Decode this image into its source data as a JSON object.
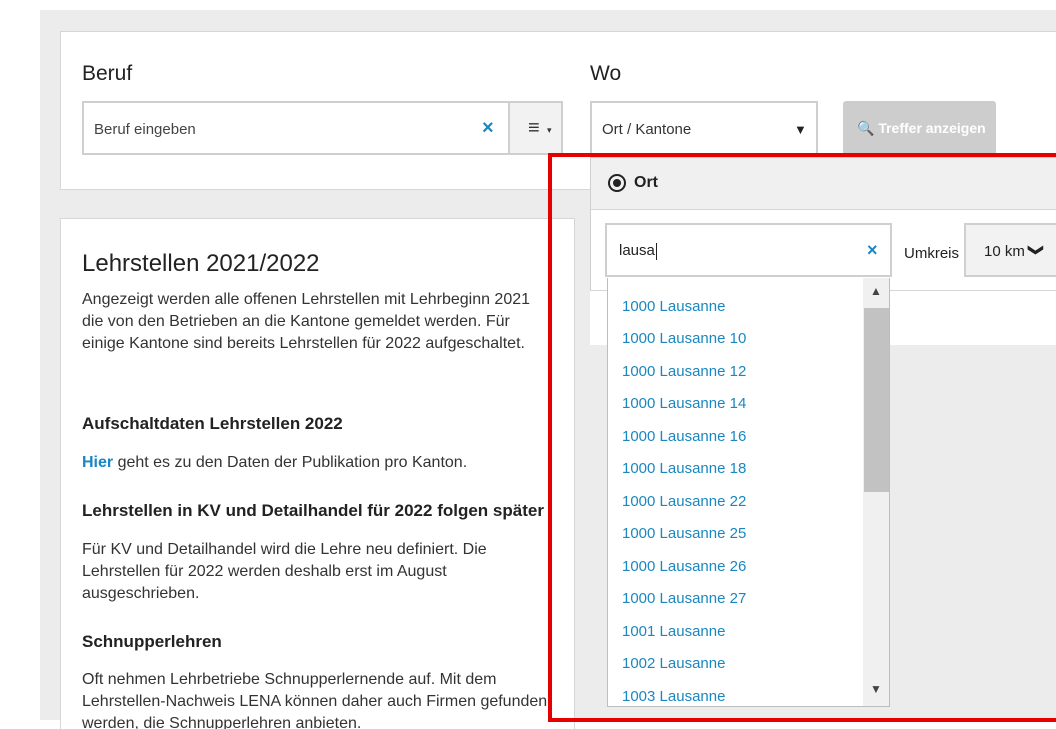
{
  "search": {
    "beruf_label": "Beruf",
    "beruf_placeholder": "Beruf eingeben",
    "clear_symbol": "×",
    "menu_icon": "≡",
    "menu_caret": "▾",
    "wo_label": "Wo",
    "wo_select_value": "Ort / Kantone",
    "wo_select_arrow": "▼",
    "treffer_button": "🔍 Treffer anzeigen"
  },
  "dropdown": {
    "ort_label": "Ort",
    "ort_input_value": "lausa",
    "umkreis_label": "Umkreis",
    "umkreis_value": "10 km",
    "umkreis_chevron": "❯",
    "suggestions": [
      "1000 Lausanne",
      "1000 Lausanne 10",
      "1000 Lausanne 12",
      "1000 Lausanne 14",
      "1000 Lausanne 16",
      "1000 Lausanne 18",
      "1000 Lausanne 22",
      "1000 Lausanne 25",
      "1000 Lausanne 26",
      "1000 Lausanne 27",
      "1001 Lausanne",
      "1002 Lausanne",
      "1003 Lausanne"
    ]
  },
  "info": {
    "title": "Lehrstellen 2021/2022",
    "intro": "Angezeigt werden alle offenen Lehrstellen mit Lehrbeginn 2021 die von den Betrieben an die Kantone gemeldet werden. Für einige Kantone sind bereits Lehrstellen für 2022 aufgeschaltet.",
    "section1_title": "Aufschaltdaten Lehrstellen 2022",
    "section1_link": "Hier",
    "section1_text": " geht es zu den Daten der Publikation pro Kanton.",
    "section2_title": "Lehrstellen in KV und Detailhandel für 2022 folgen später",
    "section2_text": "Für KV und Detailhandel wird die Lehre neu definiert. Die Lehrstellen für 2022 werden deshalb erst im August ausgeschrieben.",
    "section3_title": "Schnupperlehren",
    "section3_text": "Oft nehmen Lehrbetriebe Schnupperlernende auf. Mit dem Lehrstellen-Nachweis LENA können daher auch Firmen gefunden werden, die Schnupperlehren anbieten."
  },
  "colors": {
    "link": "#1a87c0",
    "highlight": "#e60000",
    "button_disabled": "#cdcdcd"
  }
}
